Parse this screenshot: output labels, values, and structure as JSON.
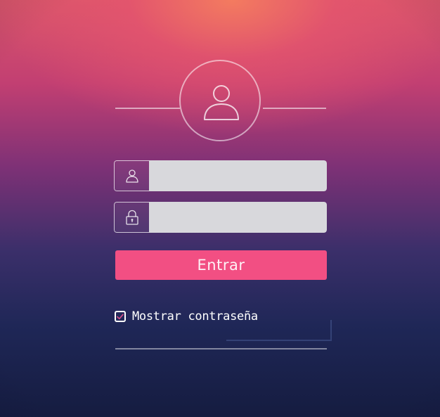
{
  "login": {
    "username_value": "",
    "password_value": "",
    "submit_label": "Entrar",
    "show_password_label": "Mostrar contraseña",
    "show_password_checked": true
  },
  "icons": {
    "avatar": "user-icon",
    "username": "user-icon",
    "password": "lock-icon",
    "checkbox": "check-icon"
  },
  "colors": {
    "accent": "#f24f83",
    "input_bg": "#d8d8dc",
    "line": "#ffffff"
  }
}
